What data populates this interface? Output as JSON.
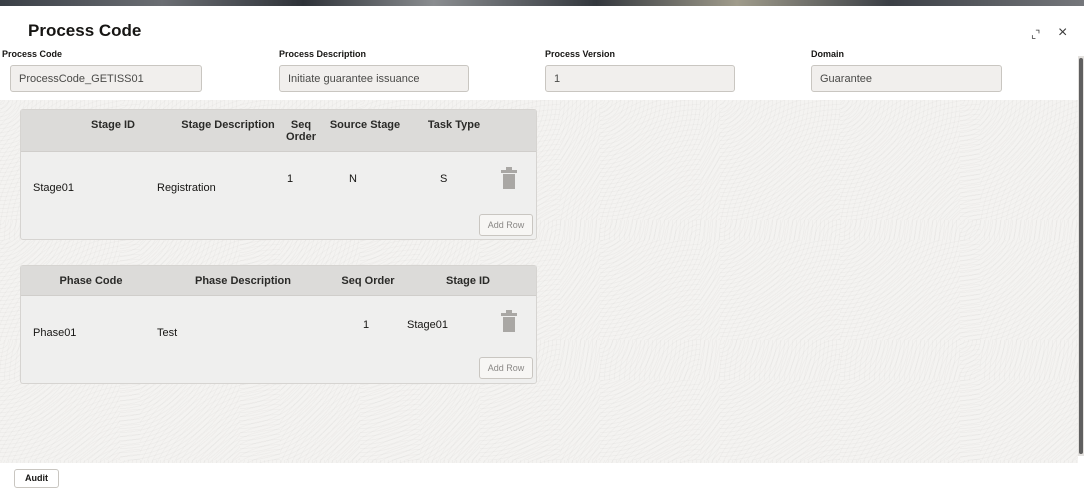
{
  "window": {
    "title": "Process Code",
    "restore_glyph": "⌞⌝",
    "close_glyph": "×"
  },
  "fields": [
    {
      "label": "Process Code",
      "value": "ProcessCode_GETISS01"
    },
    {
      "label": "Process Description",
      "value": "Initiate guarantee issuance"
    },
    {
      "label": "Process Version",
      "value": "1"
    },
    {
      "label": "Domain",
      "value": "Guarantee"
    }
  ],
  "stage_grid": {
    "columns": [
      "Stage ID",
      "Stage Description",
      "Seq Order",
      "Source Stage",
      "Task Type"
    ],
    "rows": [
      {
        "stage_id": "Stage01",
        "stage_description": "Registration",
        "seq_order": "1",
        "source_stage": "N",
        "task_type": "S"
      }
    ],
    "add_row_label": "Add Row"
  },
  "phase_grid": {
    "columns": [
      "Phase Code",
      "Phase Description",
      "Seq Order",
      "Stage ID"
    ],
    "rows": [
      {
        "phase_code": "Phase01",
        "phase_description": "Test",
        "seq_order": "1",
        "stage_id": "Stage01"
      }
    ],
    "add_row_label": "Add Row"
  },
  "footer": {
    "audit_label": "Audit"
  },
  "icons": {
    "delete": "trash-icon",
    "restore": "restore-icon",
    "close": "close-icon"
  },
  "colors": {
    "header_bg": "#dcdbd9",
    "panel_bg": "#efefee",
    "input_bg": "#f1efed",
    "text": "#161513"
  }
}
